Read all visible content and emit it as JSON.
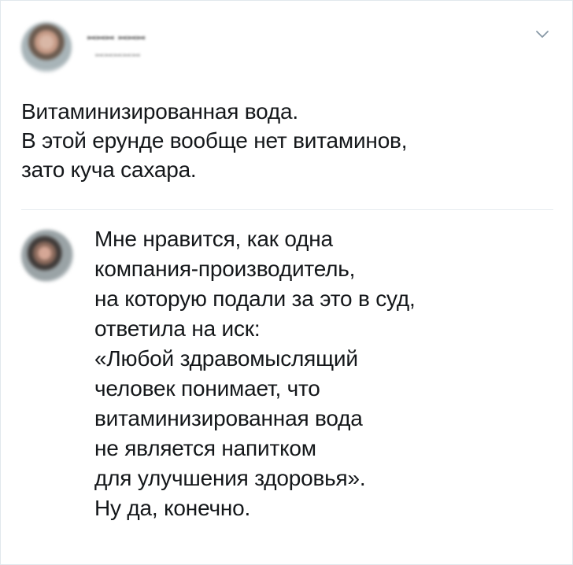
{
  "tweet": {
    "author": {
      "name": "",
      "handle": ""
    },
    "text_lines": [
      "Витаминизированная вода.",
      "В этой ерунде вообще нет витаминов,",
      "зато куча сахара."
    ]
  },
  "reply": {
    "text_lines": [
      "Мне нравится, как одна",
      "компания-производитель,",
      "на которую подали за это в суд,",
      "ответила на иск:",
      "«Любой здравомыслящий",
      "человек понимает, что",
      "витаминизированная вода",
      "не является напитком",
      "для улучшения здоровья».",
      "Ну да, конечно."
    ]
  },
  "icons": {
    "menu": "chevron-down-icon"
  },
  "colors": {
    "text": "#14171a",
    "border": "#e1e8ed",
    "chevron": "#8899a6"
  }
}
